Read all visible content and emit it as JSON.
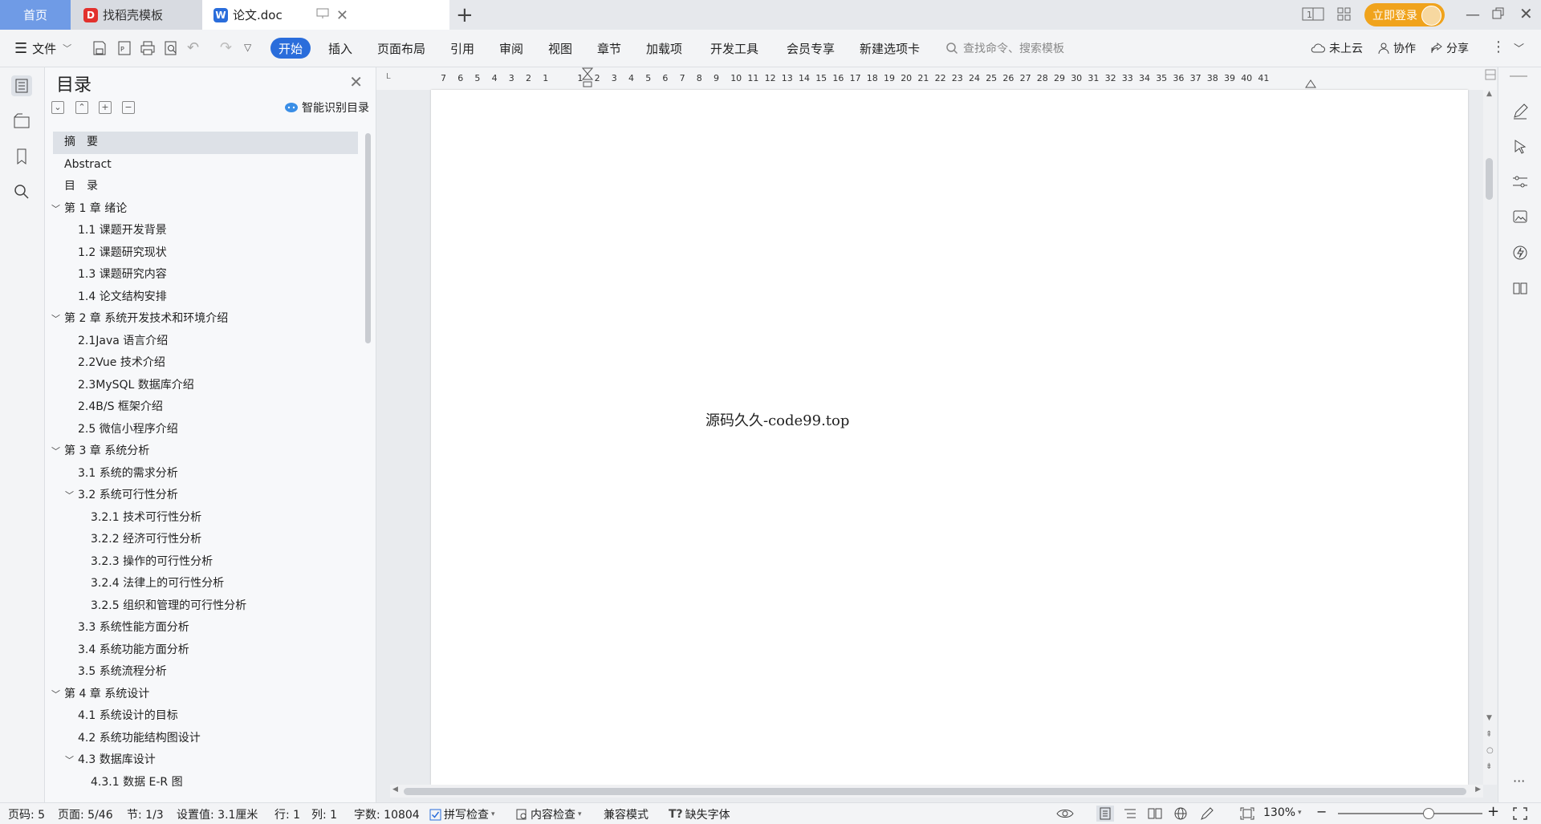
{
  "tabs": {
    "home": "首页",
    "template": "找稻壳模板",
    "document": "论文.doc",
    "add": "+",
    "login": "立即登录"
  },
  "ribbon": {
    "file": "文件",
    "menus": [
      "开始",
      "插入",
      "页面布局",
      "引用",
      "审阅",
      "视图",
      "章节",
      "加载项",
      "开发工具",
      "会员专享",
      "新建选项卡"
    ],
    "search_placeholder": "查找命令、搜索模板",
    "cloud": "未上云",
    "collab": "协作",
    "share": "分享"
  },
  "toc": {
    "title": "目录",
    "smart": "智能识别目录",
    "items": [
      {
        "text": "摘　要",
        "level": 0
      },
      {
        "text": "Abstract",
        "level": 0
      },
      {
        "text": "目　录",
        "level": 0
      },
      {
        "text": "第 1 章  绪论",
        "level": 0
      },
      {
        "text": "1.1 课题开发背景",
        "level": 1
      },
      {
        "text": "1.2 课题研究现状",
        "level": 1
      },
      {
        "text": " 1.3 课题研究内容",
        "level": 1
      },
      {
        "text": "1.4 论文结构安排",
        "level": 1
      },
      {
        "text": "第 2 章  系统开发技术和环境介绍",
        "level": 0
      },
      {
        "text": "2.1Java 语言介绍",
        "level": 1
      },
      {
        "text": "2.2Vue 技术介绍",
        "level": 1
      },
      {
        "text": "2.3MySQL 数据库介绍",
        "level": 1
      },
      {
        "text": "2.4B/S 框架介绍",
        "level": 1
      },
      {
        "text": "2.5 微信小程序介绍",
        "level": 1
      },
      {
        "text": "第 3 章  系统分析",
        "level": 0
      },
      {
        "text": "3.1 系统的需求分析",
        "level": 1
      },
      {
        "text": "3.2 系统可行性分析",
        "level": 1
      },
      {
        "text": "3.2.1 技术可行性分析",
        "level": 2
      },
      {
        "text": "3.2.2 经济可行性分析",
        "level": 2
      },
      {
        "text": "3.2.3 操作的可行性分析",
        "level": 2
      },
      {
        "text": "3.2.4 法律上的可行性分析",
        "level": 2
      },
      {
        "text": "3.2.5 组织和管理的可行性分析",
        "level": 2
      },
      {
        "text": "3.3 系统性能方面分析",
        "level": 1
      },
      {
        "text": "3.4 系统功能方面分析",
        "level": 1
      },
      {
        "text": "3.5 系统流程分析",
        "level": 1
      },
      {
        "text": "第 4 章  系统设计",
        "level": 0
      },
      {
        "text": "4.1 系统设计的目标",
        "level": 1
      },
      {
        "text": "4.2 系统功能结构图设计",
        "level": 1
      },
      {
        "text": "4.3 数据库设计",
        "level": 1
      },
      {
        "text": "4.3.1 数据 E-R 图",
        "level": 2
      }
    ]
  },
  "ruler_numbers": [
    "7",
    "6",
    "5",
    "4",
    "3",
    "2",
    "1",
    "1",
    "2",
    "3",
    "4",
    "5",
    "6",
    "7",
    "8",
    "9",
    "10",
    "11",
    "12",
    "13",
    "14",
    "15",
    "16",
    "17",
    "18",
    "19",
    "20",
    "21",
    "22",
    "23",
    "24",
    "25",
    "26",
    "27",
    "28",
    "29",
    "30",
    "31",
    "32",
    "33",
    "34",
    "35",
    "36",
    "37",
    "38",
    "39",
    "40",
    "41"
  ],
  "document": {
    "watermark": "源码久久-code99.top"
  },
  "status": {
    "page_code": "页码: 5",
    "page": "页面: 5/46",
    "section": "节: 1/3",
    "setting": "设置值: 3.1厘米",
    "row": "行: 1",
    "col": "列: 1",
    "words": "字数: 10804",
    "spell": "拼写检查",
    "content_check": "内容检查",
    "compat": "兼容模式",
    "missing_font": "缺失字体",
    "zoom": "130%",
    "zoom_level": 0.62
  },
  "colors": {
    "accent": "#2a6ddb",
    "home_tab": "#6f9be6",
    "login": "#f0a31c",
    "tpl_icon": "#e2312d"
  }
}
